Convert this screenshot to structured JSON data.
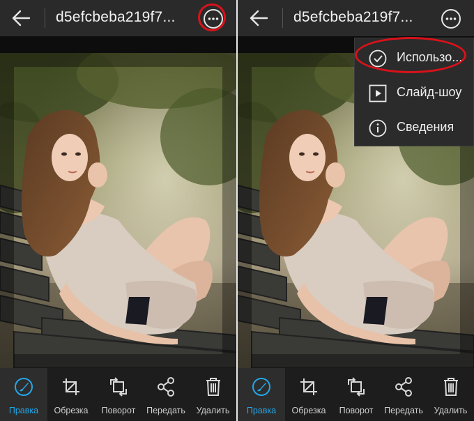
{
  "screens": [
    {
      "title": "d5efcbeba219f7...",
      "toolbar": [
        {
          "label": "Правка",
          "icon": "brush-icon",
          "active": true
        },
        {
          "label": "Обрезка",
          "icon": "crop-icon"
        },
        {
          "label": "Поворот",
          "icon": "rotate-icon"
        },
        {
          "label": "Передать",
          "icon": "share-icon"
        },
        {
          "label": "Удалить",
          "icon": "trash-icon"
        }
      ]
    },
    {
      "title": "d5efcbeba219f7...",
      "menu": [
        {
          "label": "Использо...",
          "icon": "check-circle-icon"
        },
        {
          "label": "Слайд-шоу",
          "icon": "play-square-icon"
        },
        {
          "label": "Сведения",
          "icon": "info-circle-icon"
        }
      ],
      "toolbar": [
        {
          "label": "Правка",
          "icon": "brush-icon",
          "active": true
        },
        {
          "label": "Обрезка",
          "icon": "crop-icon"
        },
        {
          "label": "Поворот",
          "icon": "rotate-icon"
        },
        {
          "label": "Передать",
          "icon": "share-icon"
        },
        {
          "label": "Удалить",
          "icon": "trash-icon"
        }
      ]
    }
  ],
  "colors": {
    "accent": "#22a7e8",
    "highlight": "#d8121a",
    "bar": "#2a2a2a"
  }
}
